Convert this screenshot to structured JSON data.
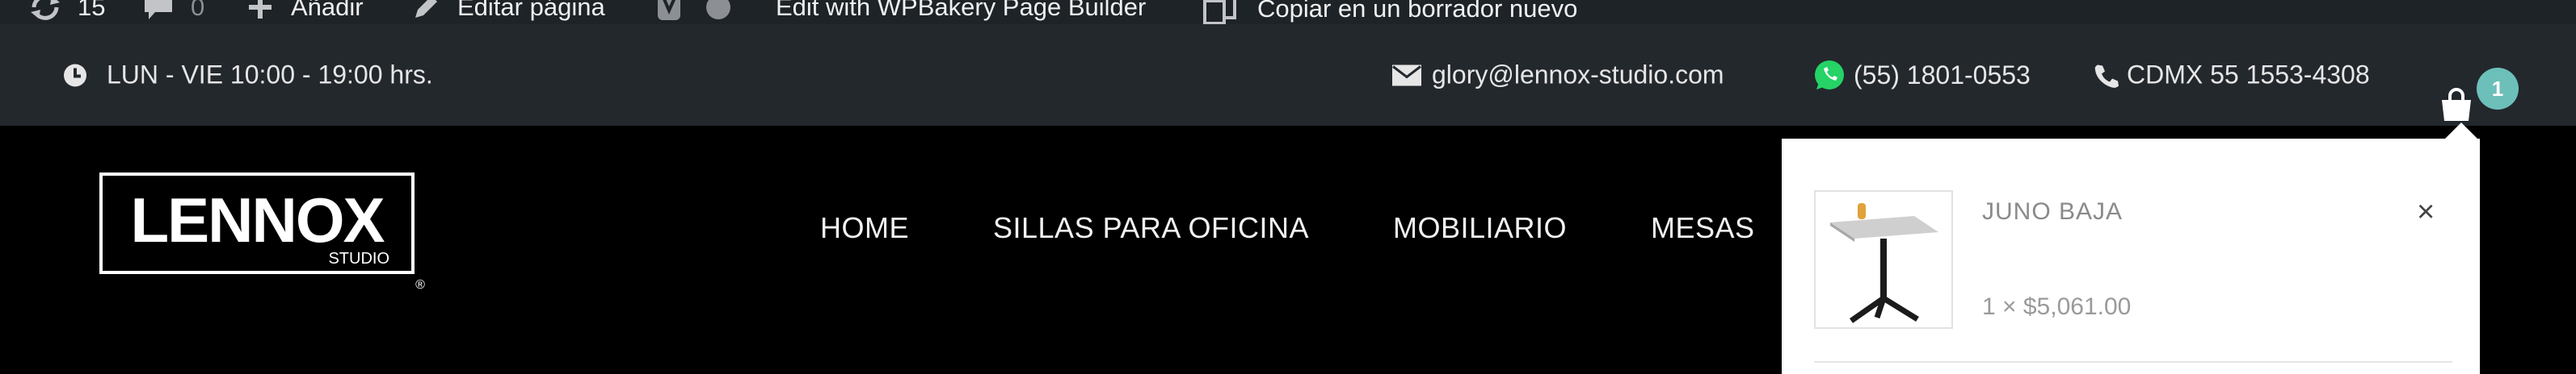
{
  "admin_bar": {
    "updates_count": "15",
    "comments_count": "0",
    "add_new_label": "Añadir",
    "edit_page_label": "Editar página",
    "wpbakery_label": "Edit with WPBakery Page Builder",
    "copy_draft_label": "Copiar en un borrador nuevo"
  },
  "top_bar": {
    "hours": "LUN - VIE 10:00 - 19:00 hrs.",
    "email": "glory@lennox-studio.com",
    "whatsapp": "(55) 1801-0553",
    "phone": "CDMX 55 1553-4308",
    "cart_count": "1"
  },
  "logo": {
    "brand": "LENNOX",
    "sub": "STUDIO",
    "mark": "®"
  },
  "nav": [
    "HOME",
    "SILLAS PARA OFICINA",
    "MOBILIARIO",
    "MESAS"
  ],
  "mini_cart": {
    "product_name": "JUNO BAJA",
    "product_qty": "1 × $5,061.00",
    "remove_symbol": "×"
  },
  "colors": {
    "admin_bar_bg": "#1d2327",
    "top_bar_bg": "#23282d",
    "badge": "#6dbfba",
    "header_bg": "#000000"
  }
}
